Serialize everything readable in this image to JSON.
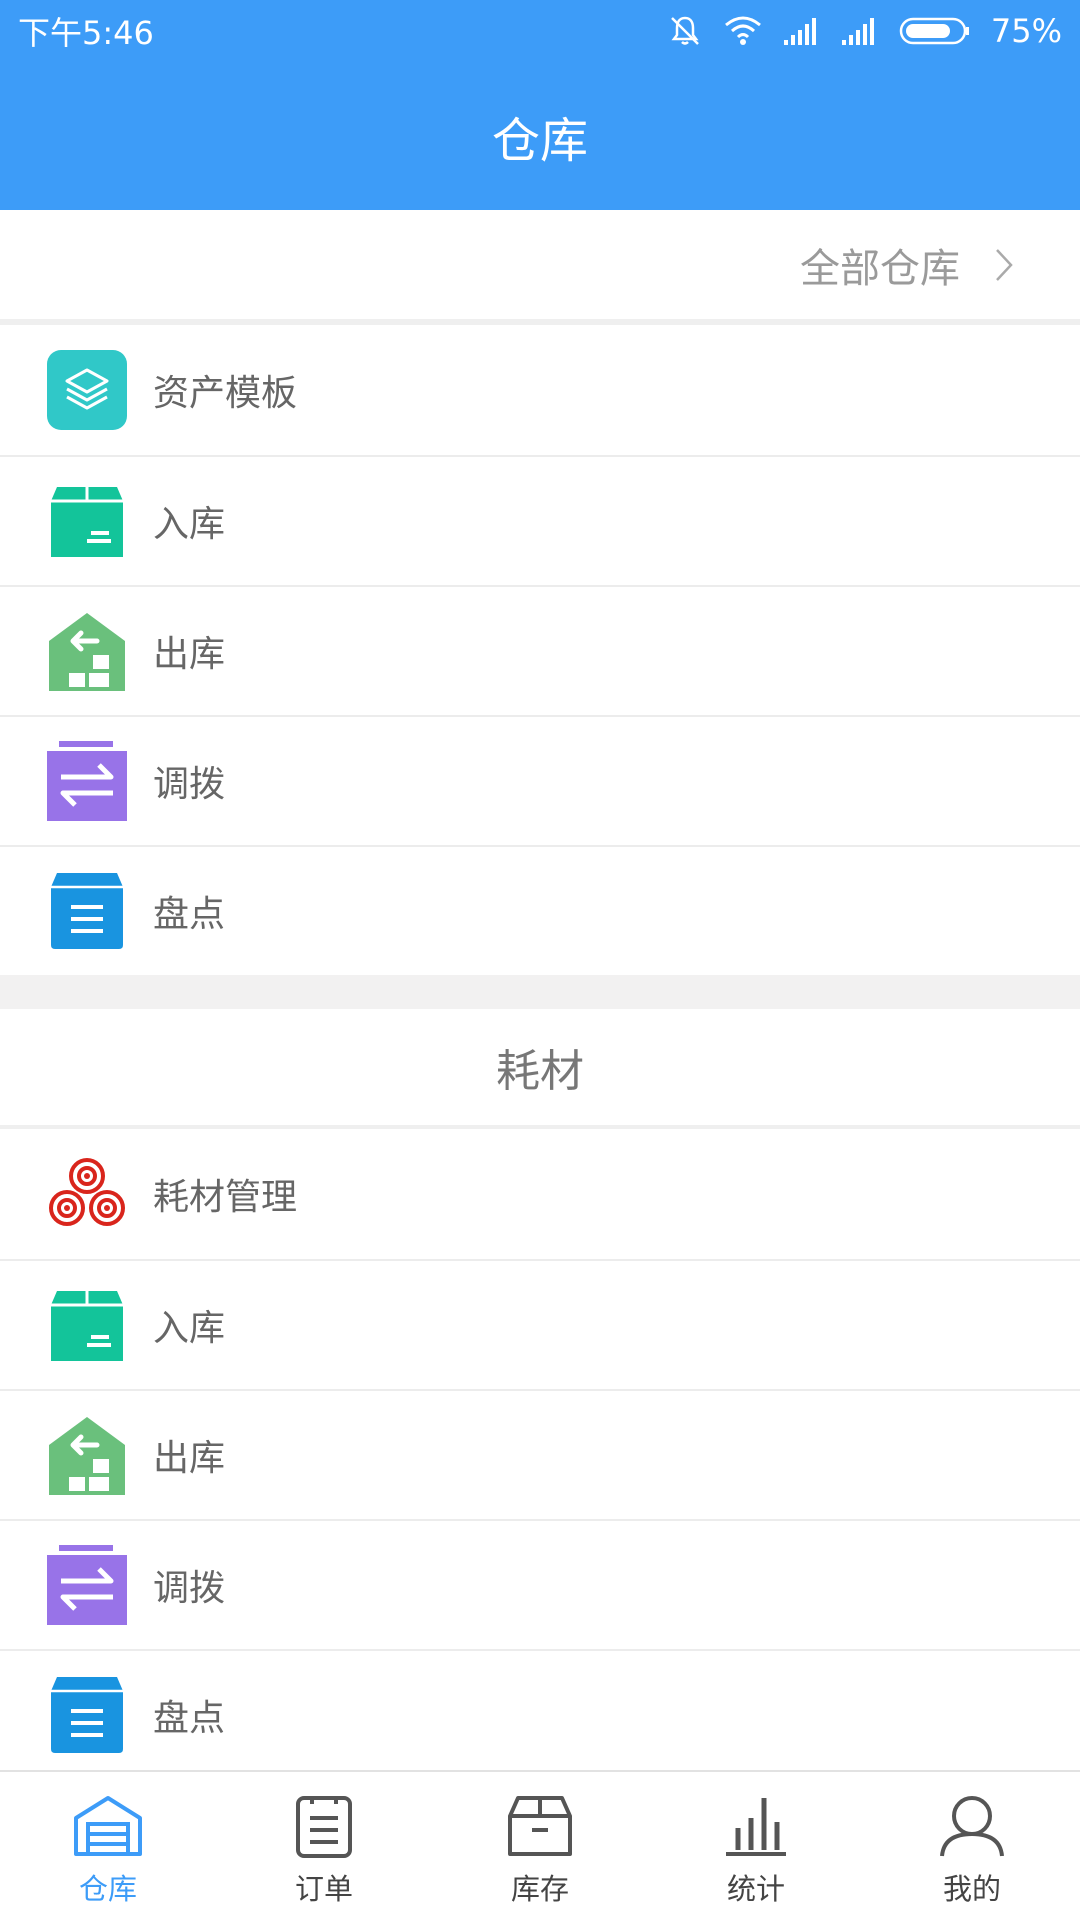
{
  "status_bar": {
    "time": "下午5:46",
    "battery": "75%"
  },
  "app_bar": {
    "title": "仓库"
  },
  "warehouse_selector": {
    "label": "全部仓库"
  },
  "asset_section": {
    "items": [
      {
        "label": "资产模板",
        "icon": "layers-icon"
      },
      {
        "label": "入库",
        "icon": "box-in-icon"
      },
      {
        "label": "出库",
        "icon": "warehouse-out-icon"
      },
      {
        "label": "调拨",
        "icon": "transfer-icon"
      },
      {
        "label": "盘点",
        "icon": "inventory-box-icon"
      }
    ]
  },
  "consumables_section": {
    "title": "耗材",
    "items": [
      {
        "label": "耗材管理",
        "icon": "rolls-icon"
      },
      {
        "label": "入库",
        "icon": "box-in-icon"
      },
      {
        "label": "出库",
        "icon": "warehouse-out-icon"
      },
      {
        "label": "调拨",
        "icon": "transfer-icon"
      },
      {
        "label": "盘点",
        "icon": "inventory-box-icon"
      }
    ]
  },
  "tab_bar": {
    "active_color": "#3d9cf8",
    "tabs": [
      {
        "label": "仓库",
        "icon": "warehouse-icon",
        "active": true
      },
      {
        "label": "订单",
        "icon": "order-icon",
        "active": false
      },
      {
        "label": "库存",
        "icon": "stock-box-icon",
        "active": false
      },
      {
        "label": "统计",
        "icon": "statistics-icon",
        "active": false
      },
      {
        "label": "我的",
        "icon": "profile-icon",
        "active": false
      }
    ]
  },
  "colors": {
    "primary": "#3d9cf8",
    "teal": "#30c8c8",
    "green": "#13c49a",
    "light_green": "#6ac07c",
    "purple": "#9873e8",
    "blue": "#1994e0",
    "red": "#d9251c"
  }
}
